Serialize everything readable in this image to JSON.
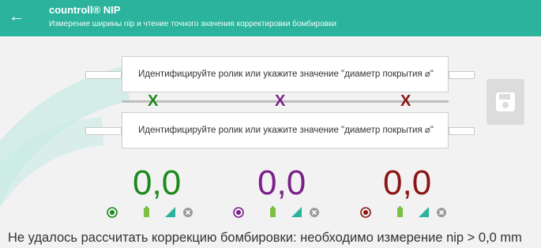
{
  "header": {
    "title": "countroll® NIP",
    "subtitle": "Измерение ширины nip и чтение точного значения корректировки бомбировки"
  },
  "rollers": [
    {
      "label": "Идентифицируйте ролик или укажите значение \"диаметр покрытия ⌀\""
    },
    {
      "label": "Идентифицируйте ролик или укажите значение \"диаметр покрытия ⌀\""
    }
  ],
  "markers": [
    {
      "symbol": "X",
      "color": "#1a8a1a"
    },
    {
      "symbol": "X",
      "color": "#7b1f8a"
    },
    {
      "symbol": "X",
      "color": "#8b1414"
    }
  ],
  "measurements": [
    {
      "value": "0,0",
      "color": "#1a8a1a"
    },
    {
      "value": "0,0",
      "color": "#7b1f8a"
    },
    {
      "value": "0,0",
      "color": "#8b1414"
    }
  ],
  "status": "Не удалось рассчитать коррекцию бомбировки: необходимо измерение nip > 0,0 mm",
  "colors": {
    "accent": "#2bb39e",
    "ok": "#5cbf3a",
    "signal": "#2bb39e",
    "disabled": "#9a9a9a"
  },
  "icons": [
    "back-arrow-icon",
    "save-icon",
    "radio-selected-icon",
    "battery-icon",
    "signal-icon",
    "close-circle-icon"
  ]
}
